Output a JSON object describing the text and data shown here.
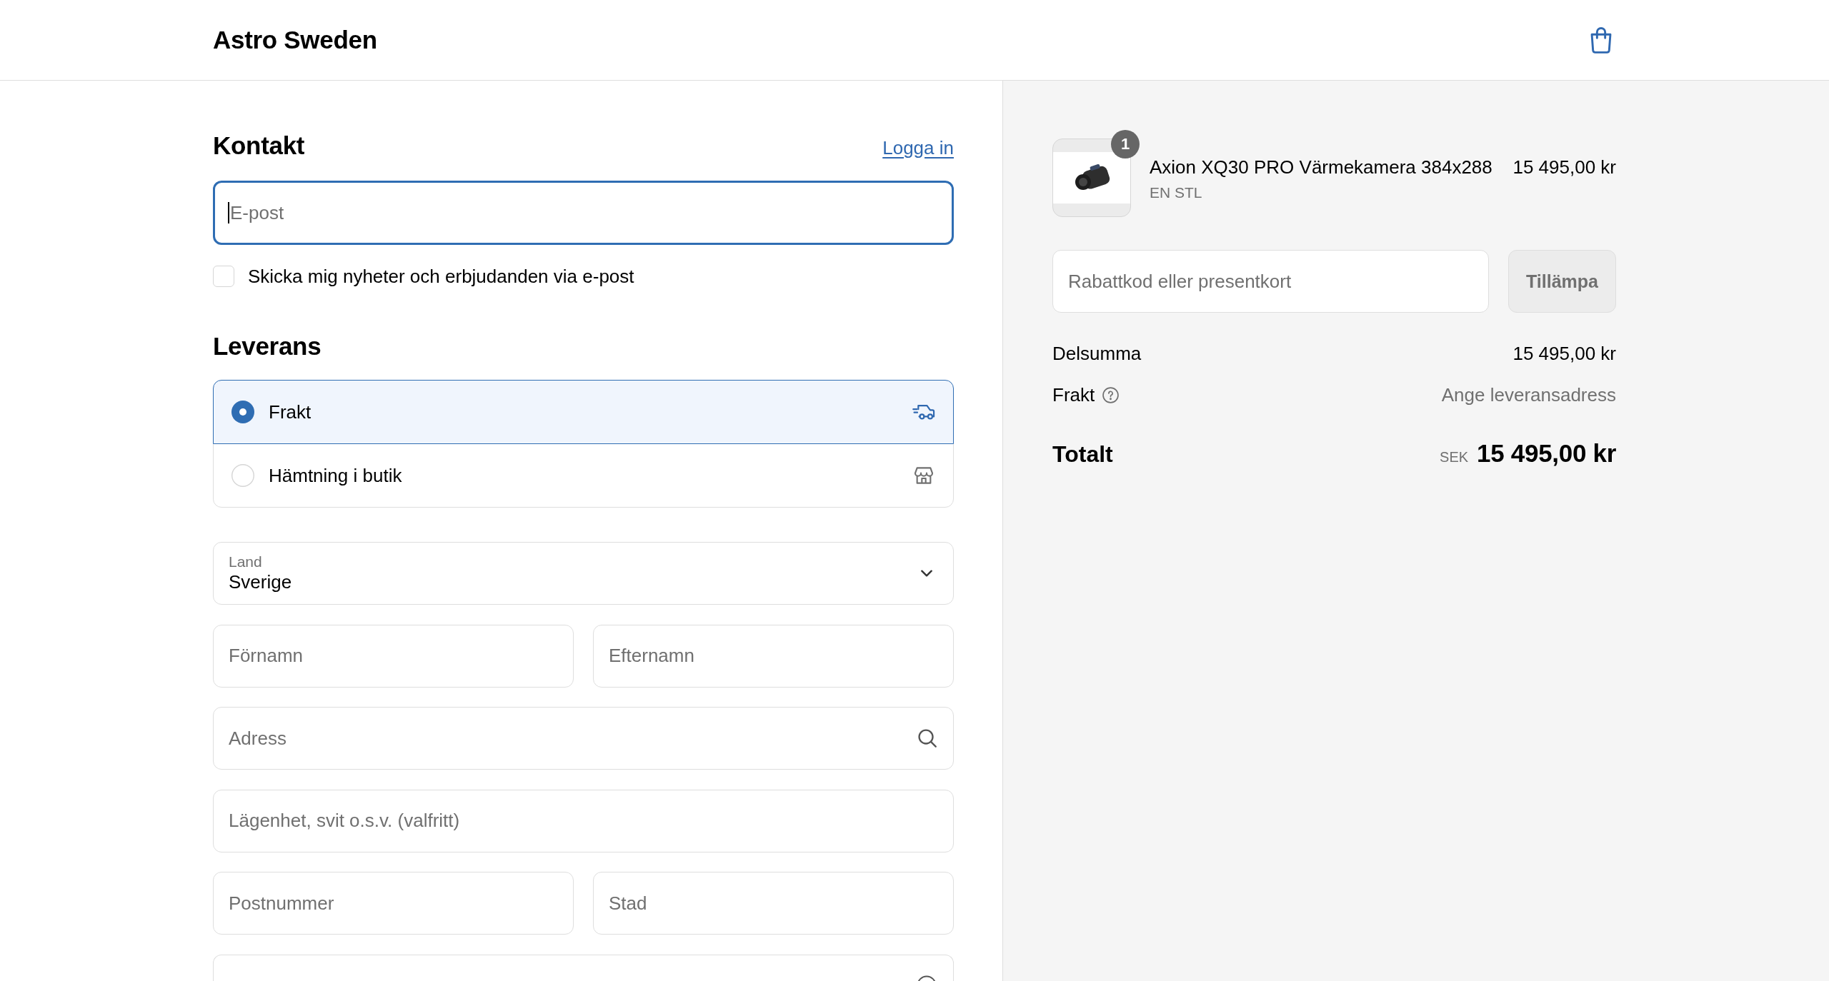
{
  "header": {
    "store_name": "Astro Sweden"
  },
  "contact": {
    "title": "Kontakt",
    "login_link": "Logga in",
    "email": {
      "placeholder": "E-post",
      "focused": true
    },
    "newsletter": {
      "label": "Skicka mig nyheter och erbjudanden via e-post",
      "checked": false
    }
  },
  "delivery": {
    "title": "Leverans",
    "methods": [
      {
        "kind": "ship",
        "label": "Frakt",
        "selected": true
      },
      {
        "kind": "pickup",
        "label": "Hämtning i butik",
        "selected": false
      }
    ],
    "address_rows": [
      [
        {
          "kind": "select",
          "label": "Land",
          "value": "Sverige"
        }
      ],
      [
        {
          "kind": "text",
          "placeholder": "Förnamn"
        },
        {
          "kind": "text",
          "placeholder": "Efternamn"
        }
      ],
      [
        {
          "kind": "search",
          "placeholder": "Adress"
        }
      ],
      [
        {
          "kind": "text",
          "placeholder": "Lägenhet, svit o.s.v. (valfritt)"
        }
      ],
      [
        {
          "kind": "text",
          "placeholder": "Postnummer"
        },
        {
          "kind": "text",
          "placeholder": "Stad"
        }
      ],
      [
        {
          "kind": "help"
        }
      ]
    ]
  },
  "summary": {
    "items": [
      {
        "quantity": "1",
        "name": "Axion XQ30 PRO Värmekamera 384x288",
        "variant": "EN STL",
        "price": "15 495,00 kr"
      }
    ],
    "discount": {
      "placeholder": "Rabattkod eller presentkort",
      "button": "Tillämpa",
      "button_disabled": true
    },
    "lines": [
      {
        "kind": "amount",
        "label": "Delsumma",
        "value": "15 495,00 kr"
      },
      {
        "kind": "info",
        "label": "Frakt",
        "value": "Ange leveransadress"
      }
    ],
    "total": {
      "label": "Totalt",
      "currency": "SEK",
      "amount": "15 495,00 kr"
    }
  }
}
